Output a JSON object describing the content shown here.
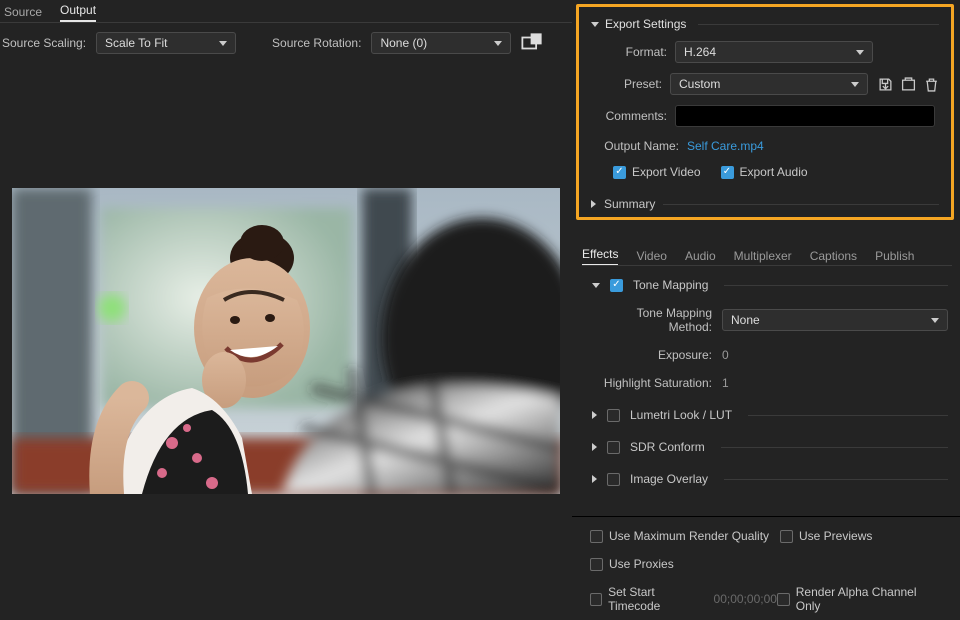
{
  "leftTabs": {
    "source": "Source",
    "output": "Output"
  },
  "sourceScaling": {
    "label": "Source Scaling:",
    "value": "Scale To Fit"
  },
  "sourceRotation": {
    "label": "Source Rotation:",
    "value": "None (0)"
  },
  "exportSettings": {
    "title": "Export Settings",
    "formatLabel": "Format:",
    "formatValue": "H.264",
    "presetLabel": "Preset:",
    "presetValue": "Custom",
    "commentsLabel": "Comments:",
    "commentsValue": "",
    "outputNameLabel": "Output Name:",
    "outputNameValue": "Self Care.mp4",
    "exportVideo": "Export Video",
    "exportAudio": "Export Audio",
    "summary": "Summary"
  },
  "fxTabs": {
    "effects": "Effects",
    "video": "Video",
    "audio": "Audio",
    "multiplexer": "Multiplexer",
    "captions": "Captions",
    "publish": "Publish"
  },
  "toneMapping": {
    "title": "Tone Mapping",
    "methodLabel": "Tone Mapping Method:",
    "methodValue": "None",
    "exposureLabel": "Exposure:",
    "exposureValue": "0",
    "highlightLabel": "Highlight Saturation:",
    "highlightValue": "1"
  },
  "collapsedSections": {
    "lumetri": "Lumetri Look / LUT",
    "sdr": "SDR Conform",
    "overlay": "Image Overlay"
  },
  "bottom": {
    "maxRender": "Use Maximum Render Quality",
    "previews": "Use Previews",
    "proxies": "Use Proxies",
    "startTC": "Set Start Timecode",
    "startTCValue": "00;00;00;00",
    "alphaOnly": "Render Alpha Channel Only"
  }
}
